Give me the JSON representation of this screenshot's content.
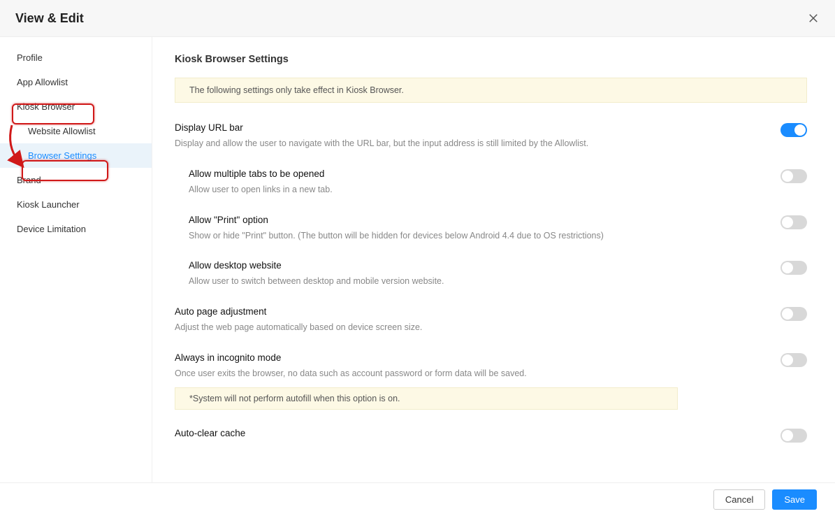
{
  "header": {
    "title": "View & Edit"
  },
  "sidebar": {
    "items": [
      {
        "label": "Profile"
      },
      {
        "label": "App Allowlist"
      },
      {
        "label": "Kiosk Browser"
      },
      {
        "label": "Website Allowlist"
      },
      {
        "label": "Browser Settings"
      },
      {
        "label": "Brand"
      },
      {
        "label": "Kiosk Launcher"
      },
      {
        "label": "Device Limitation"
      }
    ]
  },
  "main": {
    "title": "Kiosk Browser Settings",
    "notice": "The following settings only take effect in Kiosk Browser.",
    "settings": [
      {
        "title": "Display URL bar",
        "desc_pre": "Display and allow the user to navigate with the URL bar, but the input address is still limited by the ",
        "desc_link": "Allowlist",
        "desc_post": ".",
        "on": true
      },
      {
        "title": "Allow multiple tabs to be opened",
        "desc": "Allow user to open links in a new tab.",
        "on": false
      },
      {
        "title": "Allow \"Print\" option",
        "desc": "Show or hide \"Print\" button. (The button will be hidden for devices below Android 4.4 due to OS restrictions)",
        "on": false
      },
      {
        "title": "Allow desktop website",
        "desc": "Allow user to switch between desktop and mobile version website.",
        "on": false
      },
      {
        "title": "Auto page adjustment",
        "desc": "Adjust the web page automatically based on device screen size.",
        "on": false
      },
      {
        "title": "Always in incognito mode",
        "desc": "Once user exits the browser, no data such as account password or form data will be saved.",
        "sub_notice": "*System will not perform autofill when this option is on.",
        "on": false
      },
      {
        "title": "Auto-clear cache",
        "desc": "",
        "on": false
      }
    ]
  },
  "footer": {
    "cancel": "Cancel",
    "save": "Save"
  }
}
